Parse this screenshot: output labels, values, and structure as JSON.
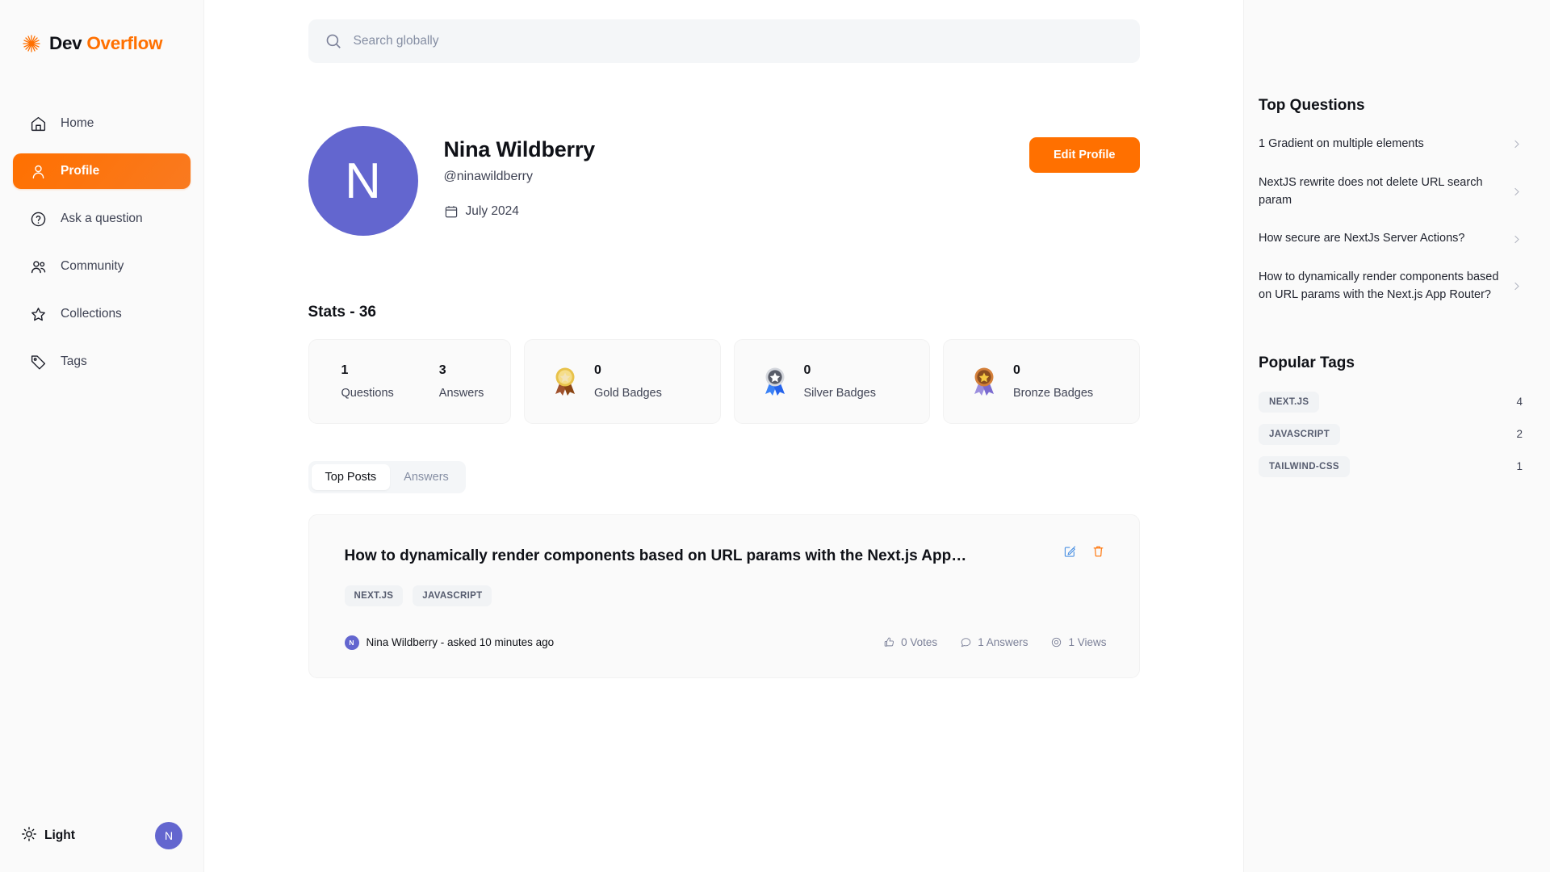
{
  "brand": {
    "name_prefix": "Dev",
    "name_accent": "Overflow",
    "logo_icon": "sun-burst-logo-icon"
  },
  "sidebar": {
    "items": [
      {
        "label": "Home",
        "icon": "home-icon",
        "active": false
      },
      {
        "label": "Profile",
        "icon": "user-icon",
        "active": true
      },
      {
        "label": "Ask a question",
        "icon": "question-circle-icon",
        "active": false
      },
      {
        "label": "Community",
        "icon": "users-icon",
        "active": false
      },
      {
        "label": "Collections",
        "icon": "star-icon",
        "active": false
      },
      {
        "label": "Tags",
        "icon": "tag-icon",
        "active": false
      }
    ],
    "footer": {
      "theme_label": "Light",
      "theme_icon": "sun-icon",
      "avatar_initial": "N"
    }
  },
  "search": {
    "placeholder": "Search globally",
    "value": "",
    "icon": "search-icon"
  },
  "profile": {
    "avatar_initial": "N",
    "name": "Nina Wildberry",
    "handle": "@ninawildberry",
    "joined": "July 2024",
    "joined_icon": "calendar-icon",
    "edit_button": "Edit Profile"
  },
  "stats": {
    "title": "Stats - 36",
    "counts": [
      {
        "value": "1",
        "label": "Questions"
      },
      {
        "value": "3",
        "label": "Answers"
      }
    ],
    "badges": [
      {
        "value": "0",
        "label": "Gold Badges",
        "icon": "gold-medal-icon"
      },
      {
        "value": "0",
        "label": "Silver Badges",
        "icon": "silver-medal-icon"
      },
      {
        "value": "0",
        "label": "Bronze Badges",
        "icon": "bronze-medal-icon"
      }
    ]
  },
  "tabs": [
    {
      "label": "Top Posts",
      "active": true
    },
    {
      "label": "Answers",
      "active": false
    }
  ],
  "post": {
    "title": "How to dynamically render components based on URL params with the Next.js App…",
    "tags": [
      "NEXT.JS",
      "JAVASCRIPT"
    ],
    "author": "Nina Wildberry - asked 10 minutes ago",
    "author_initial": "N",
    "metrics": [
      {
        "value": "0 Votes",
        "icon": "thumbs-up-icon"
      },
      {
        "value": "1 Answers",
        "icon": "message-icon"
      },
      {
        "value": "1 Views",
        "icon": "eye-icon"
      }
    ],
    "edit_icon": "edit-pencil-icon",
    "delete_icon": "trash-icon"
  },
  "right": {
    "top_questions_title": "Top Questions",
    "top_questions": [
      "1 Gradient on multiple elements",
      "NextJS rewrite does not delete URL search param",
      "How secure are NextJs Server Actions?",
      "How to dynamically render components based on URL params with the Next.js App Router?"
    ],
    "popular_tags_title": "Popular Tags",
    "popular_tags": [
      {
        "name": "NEXT.JS",
        "count": "4"
      },
      {
        "name": "JAVASCRIPT",
        "count": "2"
      },
      {
        "name": "TAILWIND-CSS",
        "count": "1"
      }
    ]
  },
  "colors": {
    "accent": "#ff7000",
    "avatar": "#6366cf",
    "edit_icon": "#4a90e2",
    "panel": "#fafafa"
  }
}
